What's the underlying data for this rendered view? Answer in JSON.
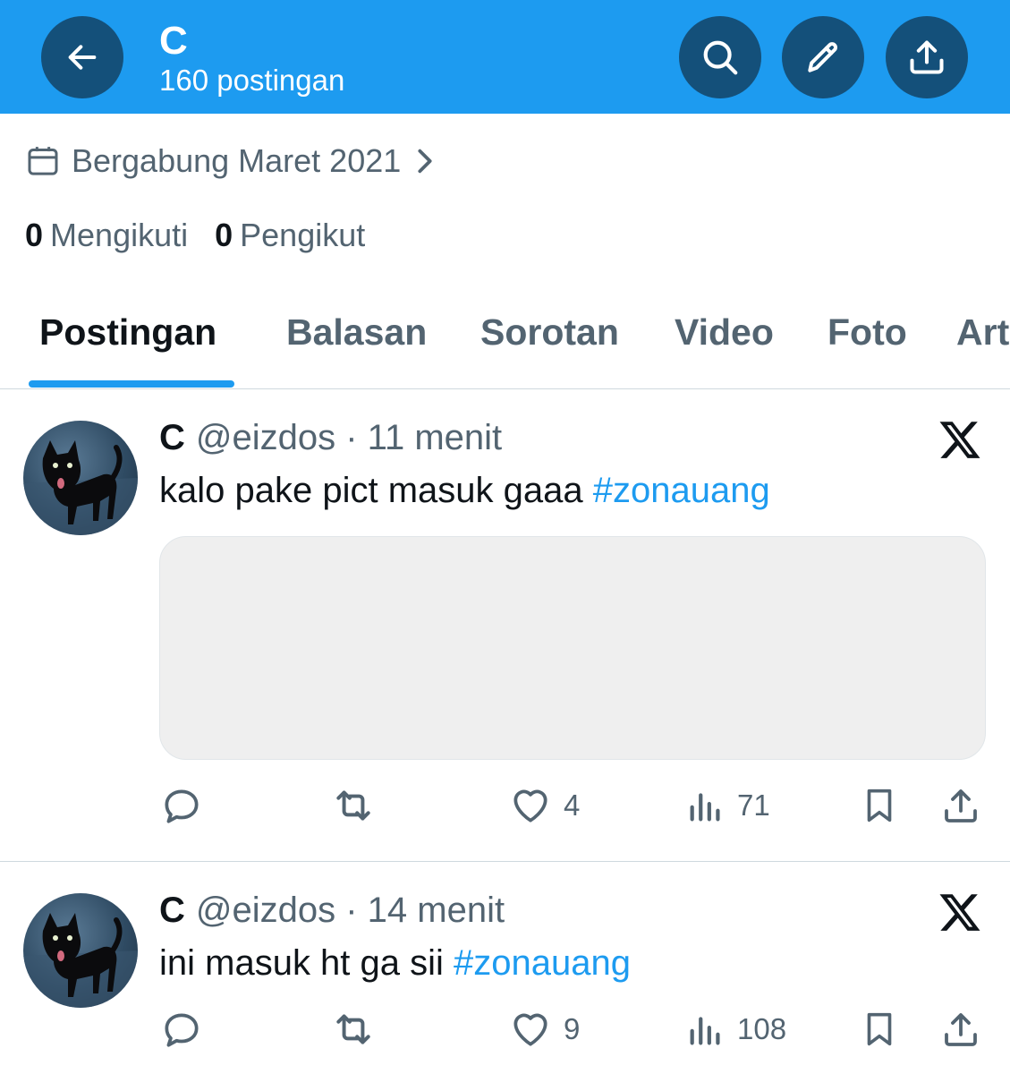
{
  "header": {
    "title": "C",
    "subtitle": "160 postingan",
    "bg_color": "#1d9bf0",
    "buttons": [
      "arrow-left-icon",
      "search-icon",
      "pencil-icon",
      "share-icon"
    ]
  },
  "profile": {
    "joined": "Bergabung Maret 2021",
    "following_count": "0",
    "following_label": "Mengikuti",
    "followers_count": "0",
    "followers_label": "Pengikut"
  },
  "tabs": [
    {
      "label": "Postingan",
      "active": true
    },
    {
      "label": "Balasan",
      "active": false
    },
    {
      "label": "Sorotan",
      "active": false
    },
    {
      "label": "Video",
      "active": false
    },
    {
      "label": "Foto",
      "active": false
    },
    {
      "label": "Artikel",
      "active": false
    }
  ],
  "posts": [
    {
      "name": "C",
      "handle": "@eizdos",
      "time": "· 11 menit",
      "text": "kalo pake pict masuk gaaa ",
      "hashtag": "#zonauang",
      "has_media": true,
      "likes": "4",
      "views": "71"
    },
    {
      "name": "C",
      "handle": "@eizdos",
      "time": "· 14 menit",
      "text": "ini masuk ht ga sii ",
      "hashtag": "#zonauang",
      "has_media": false,
      "likes": "9",
      "views": "108"
    }
  ],
  "colors": {
    "accent": "#1d9bf0",
    "header_button": "#14507a",
    "secondary_text": "#536471"
  }
}
